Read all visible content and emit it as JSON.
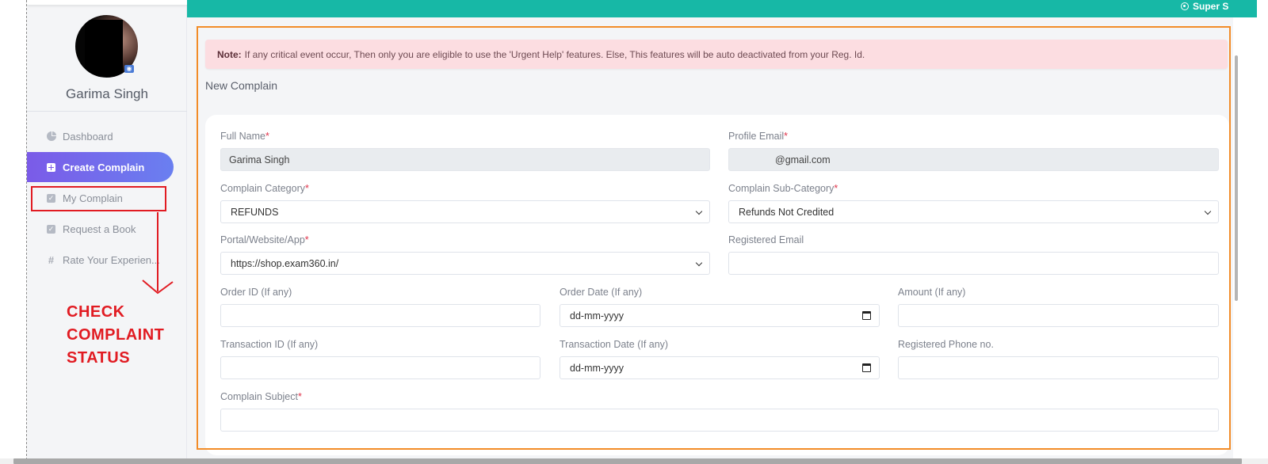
{
  "user": {
    "name": "Garima Singh"
  },
  "sidebar": {
    "items": [
      {
        "label": "Dashboard",
        "icon": "pie-chart-icon"
      },
      {
        "label": "Create Complain",
        "icon": "plus-square-icon",
        "active": true
      },
      {
        "label": "My Complain",
        "icon": "check-square-icon"
      },
      {
        "label": "Request a Book",
        "icon": "check-square-icon"
      },
      {
        "label": "Rate Your Experien...",
        "icon": "hash-icon"
      }
    ]
  },
  "annotation": {
    "text": "CHECK\nCOMPLAINT\nSTATUS",
    "color": "#e11b22"
  },
  "header": {
    "right_label": "Super S"
  },
  "note": {
    "prefix": "Note:",
    "text": "If any critical event occur, Then only you are eligible to use the 'Urgent Help' features. Else, This features will be auto deactivated from your Reg. Id."
  },
  "form": {
    "title": "New Complain",
    "full_name": {
      "label": "Full Name",
      "required": "*",
      "value": "Garima Singh"
    },
    "profile_email": {
      "label": "Profile Email",
      "required": "*",
      "value": "@gmail.com"
    },
    "category": {
      "label": "Complain Category",
      "required": "*",
      "value": "REFUNDS"
    },
    "sub_category": {
      "label": "Complain Sub-Category",
      "required": "*",
      "value": "Refunds Not Credited"
    },
    "portal": {
      "label": "Portal/Website/App",
      "required": "*",
      "value": "https://shop.exam360.in/"
    },
    "registered_email": {
      "label": "Registered Email",
      "value": ""
    },
    "order_id": {
      "label": "Order ID (If any)",
      "value": ""
    },
    "order_date": {
      "label": "Order Date (If any)",
      "value": "dd-mm-yyyy"
    },
    "amount": {
      "label": "Amount (If any)",
      "value": ""
    },
    "transaction_id": {
      "label": "Transaction ID (If any)",
      "value": ""
    },
    "transaction_date": {
      "label": "Transaction Date (If any)",
      "value": "dd-mm-yyyy"
    },
    "phone": {
      "label": "Registered Phone no.",
      "value": ""
    },
    "subject": {
      "label": "Complain Subject",
      "required": "*",
      "value": ""
    }
  },
  "colors": {
    "accent": "#17b8a6",
    "active_gradient_start": "#7b5be8",
    "highlight_frame": "#f28c28",
    "note_bg": "#fcdde1"
  }
}
